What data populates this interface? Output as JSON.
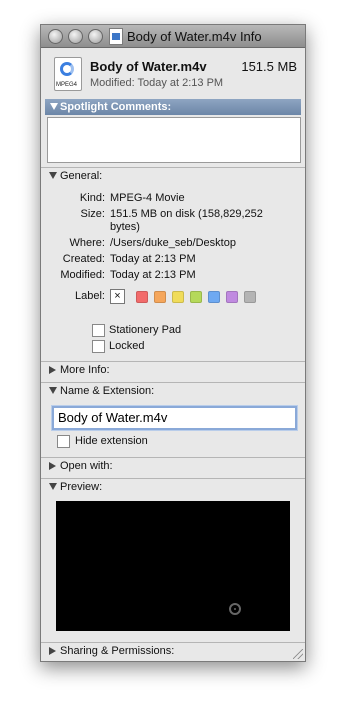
{
  "window": {
    "title": "Body of Water.m4v Info"
  },
  "header": {
    "file_icon": "mpeg4-file-icon",
    "file_icon_tag": "MPEG4",
    "file_name": "Body of Water.m4v",
    "file_size": "151.5 MB",
    "modified_line": "Modified: Today at 2:13 PM"
  },
  "spotlight": {
    "header": "Spotlight Comments:",
    "value": ""
  },
  "general": {
    "header": "General:",
    "rows": [
      {
        "key": "Kind:",
        "value": "MPEG-4 Movie"
      },
      {
        "key": "Size:",
        "value": "151.5 MB on disk (158,829,252"
      },
      {
        "key": "",
        "value": "bytes)"
      },
      {
        "key": "Where:",
        "value": "/Users/duke_seb/Desktop"
      },
      {
        "key": "Created:",
        "value": "Today at 2:13 PM"
      },
      {
        "key": "Modified:",
        "value": "Today at 2:13 PM"
      }
    ],
    "label_key": "Label:",
    "label_none": "×",
    "label_colors": [
      "#f26b6b",
      "#f5a65b",
      "#f0dc5a",
      "#b5d95a",
      "#6ea9f2",
      "#c08ae0",
      "#b4b4b4"
    ],
    "stationery_pad": "Stationery Pad",
    "locked": "Locked"
  },
  "more_info": {
    "header": "More Info:"
  },
  "name_ext": {
    "header": "Name & Extension:",
    "value": "Body of Water.m4v",
    "hide_extension": "Hide extension"
  },
  "open_with": {
    "header": "Open with:"
  },
  "preview": {
    "header": "Preview:"
  },
  "sharing": {
    "header": "Sharing & Permissions:"
  }
}
